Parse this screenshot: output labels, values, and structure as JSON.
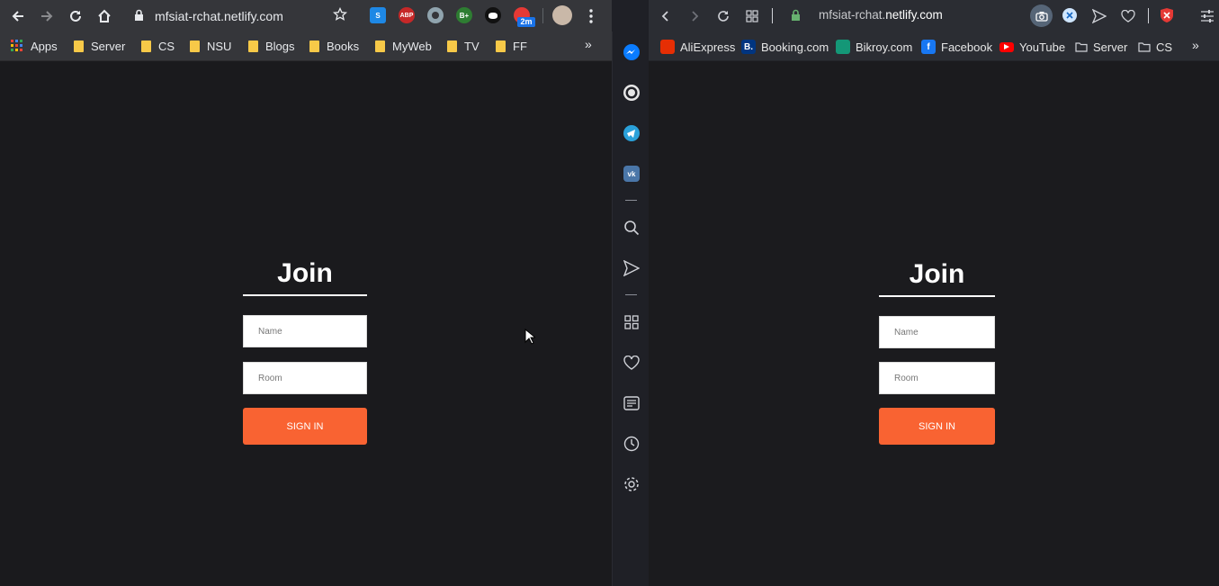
{
  "chrome": {
    "url": "mfsiat-rchat.netlify.com",
    "extension_badge": "2m",
    "bookmarks": [
      {
        "label": "Apps",
        "icon": "apps-grid-icon"
      },
      {
        "label": "Server",
        "icon": "folder-icon"
      },
      {
        "label": "CS",
        "icon": "folder-icon"
      },
      {
        "label": "NSU",
        "icon": "folder-icon"
      },
      {
        "label": "Blogs",
        "icon": "folder-icon"
      },
      {
        "label": "Books",
        "icon": "folder-icon"
      },
      {
        "label": "MyWeb",
        "icon": "folder-icon"
      },
      {
        "label": "TV",
        "icon": "folder-icon"
      },
      {
        "label": "FF",
        "icon": "folder-icon"
      }
    ],
    "more": "»"
  },
  "opera": {
    "url_prefix": "mfsiat-rchat.",
    "url_host": "netlify.com",
    "bookmarks": [
      {
        "label": "AliExpress",
        "icon": "aliexpress-icon",
        "color": "#e62e04"
      },
      {
        "label": "Booking.com",
        "icon": "booking-icon",
        "color": "#003580"
      },
      {
        "label": "Bikroy.com",
        "icon": "bikroy-icon",
        "color": "#149777"
      },
      {
        "label": "Facebook",
        "icon": "facebook-icon",
        "color": "#1877f2"
      },
      {
        "label": "YouTube",
        "icon": "youtube-icon",
        "color": "#ff0000"
      },
      {
        "label": "Server",
        "icon": "folder-outline-icon"
      },
      {
        "label": "CS",
        "icon": "folder-outline-icon"
      }
    ],
    "more": "»"
  },
  "join_form": {
    "title": "Join",
    "name_placeholder": "Name",
    "room_placeholder": "Room",
    "signin_label": "SIGN IN"
  },
  "colors": {
    "accent": "#f96332",
    "page_bg": "#1a1a1d"
  }
}
